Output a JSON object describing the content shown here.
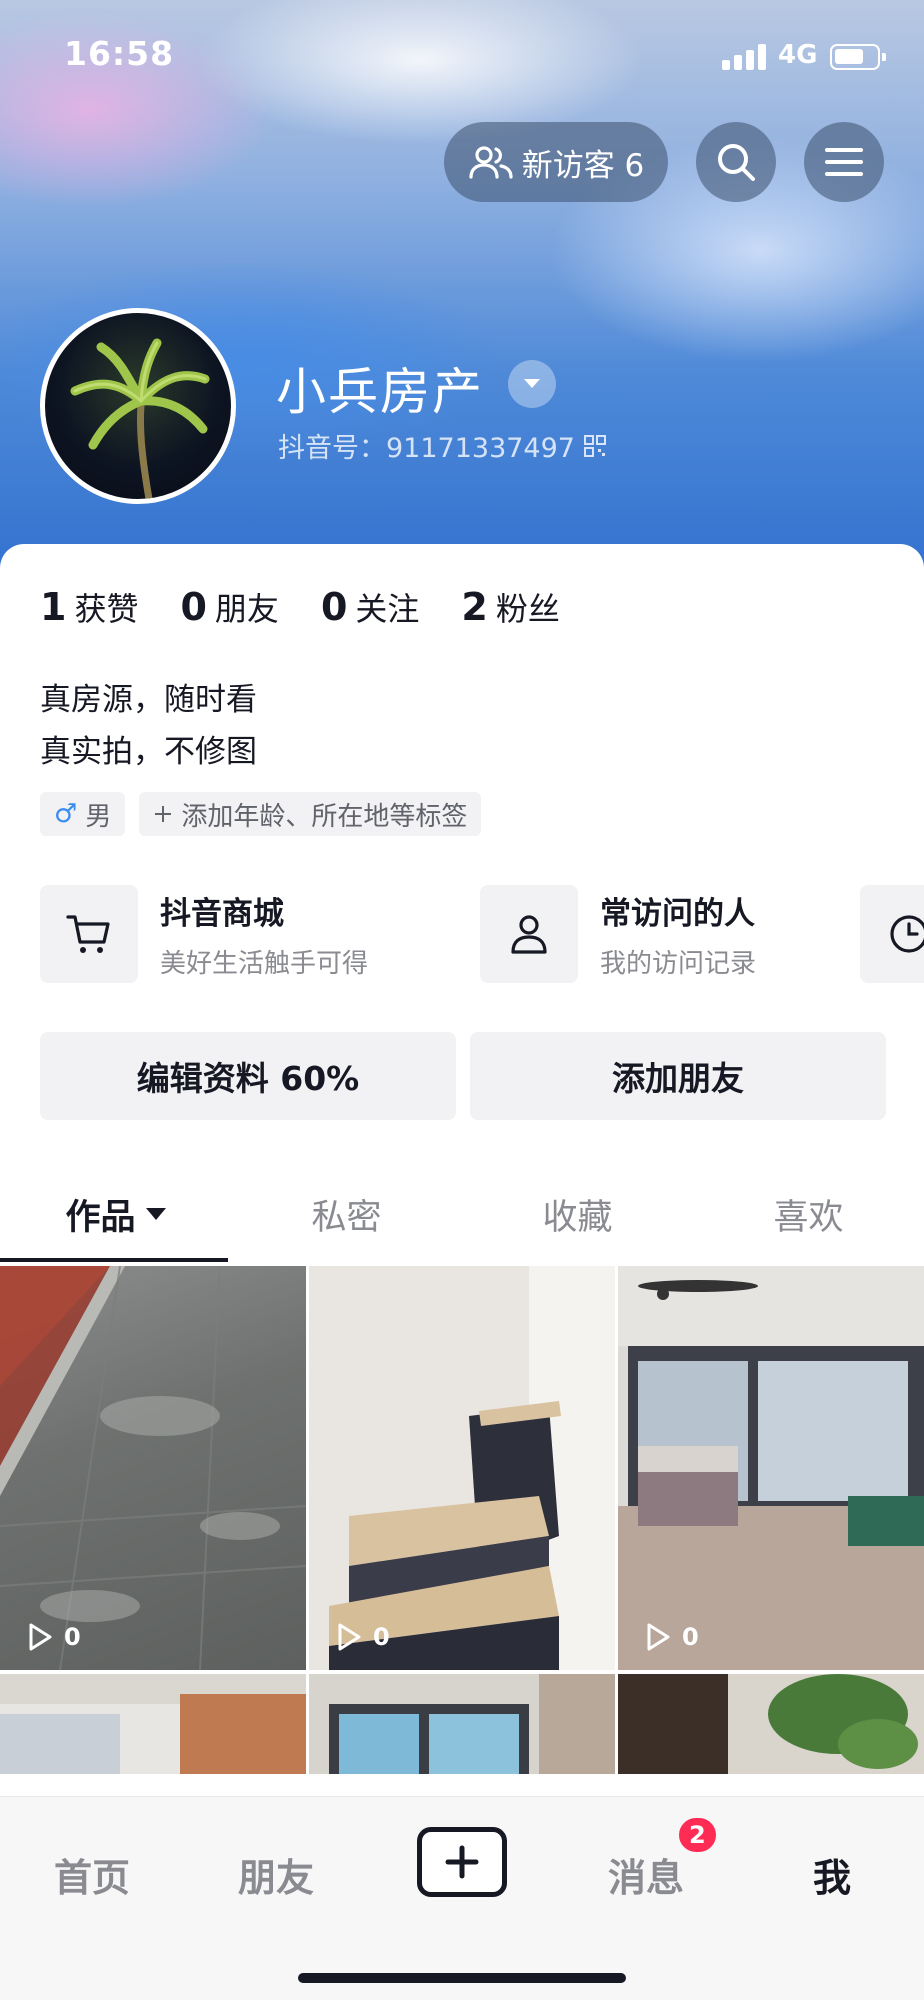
{
  "status_bar": {
    "time": "16:58",
    "network": "4G",
    "icons": [
      "signal-icon",
      "battery-icon"
    ]
  },
  "header": {
    "visitors_label": "新访客 6",
    "icons": [
      "visitors-icon",
      "search-icon",
      "menu-icon"
    ]
  },
  "profile": {
    "nickname": "小兵房产",
    "douyin_id": "抖音号：91171337497",
    "avatar_icon": "palm-tree-avatar"
  },
  "stats": [
    {
      "num": "1",
      "label": "获赞"
    },
    {
      "num": "0",
      "label": "朋友"
    },
    {
      "num": "0",
      "label": "关注"
    },
    {
      "num": "2",
      "label": "粉丝"
    }
  ],
  "bio": {
    "line1": "真房源，随时看",
    "line2": "真实拍，不修图"
  },
  "tags": {
    "gender": "男",
    "add_tag": "添加年龄、所在地等标签"
  },
  "services": [
    {
      "title": "抖音商城",
      "subtitle": "美好生活触手可得",
      "icon": "cart-icon"
    },
    {
      "title": "常访问的人",
      "subtitle": "我的访问记录",
      "icon": "person-icon"
    },
    {
      "icon": "clock-icon"
    }
  ],
  "actions": {
    "edit_profile": "编辑资料 60%",
    "add_friend": "添加朋友"
  },
  "tabs": [
    "作品",
    "私密",
    "收藏",
    "喜欢"
  ],
  "videos": [
    {
      "plays": "0"
    },
    {
      "plays": "0"
    },
    {
      "plays": "0"
    },
    {},
    {},
    {}
  ],
  "bottom_nav": {
    "home": "首页",
    "friends": "朋友",
    "messages": "消息",
    "messages_badge": "2",
    "me": "我"
  },
  "colors": {
    "accent_red": "#fe2c55",
    "text_primary": "#161823",
    "text_secondary": "#8a8b91",
    "chip_bg": "#f2f2f4"
  }
}
